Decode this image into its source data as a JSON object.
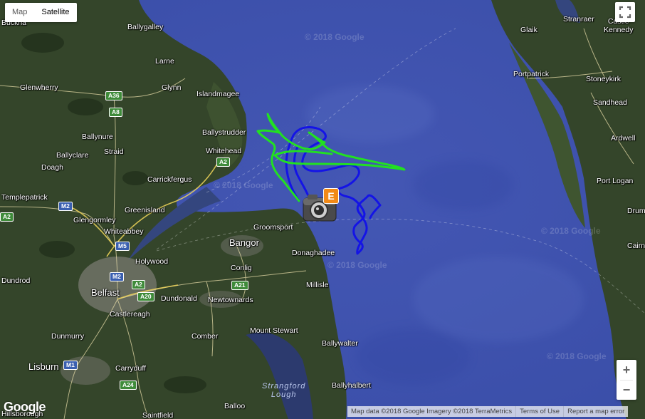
{
  "map_type": {
    "options": [
      "Map",
      "Satellite"
    ],
    "selected": "Satellite"
  },
  "controls": {
    "zoom_in": "+",
    "zoom_out": "−",
    "fullscreen_icon": "fullscreen-icon"
  },
  "watermark": "© 2018 Google",
  "labels": {
    "buckna": "Buckna",
    "ballygalley": "Ballygalley",
    "larne": "Larne",
    "glenwherry": "Glenwherry",
    "glynn": "Glynn",
    "islandmagee": "Islandmagee",
    "ballynure": "Ballynure",
    "ballystrudder": "Ballystrudder",
    "ballyclare": "Ballyclare",
    "straid": "Straid",
    "whitehead": "Whitehead",
    "doagh": "Doagh",
    "carrickfergus": "Carrickfergus",
    "templepatrick": "Templepatrick",
    "greenisland": "Greenisland",
    "glengormley": "Glengormley",
    "whiteabbey": "Whiteabbey",
    "groomsport": "Groomsport",
    "bangor": "Bangor",
    "donaghadee": "Donaghadee",
    "holywood": "Holywood",
    "conlig": "Conlig",
    "dundrod": "Dundrod",
    "belfast": "Belfast",
    "dundonald": "Dundonald",
    "newtownards": "Newtownards",
    "millisle": "Millisle",
    "castlereagh": "Castlereagh",
    "dunmurry": "Dunmurry",
    "comber": "Comber",
    "mount_stewart": "Mount Stewart",
    "ballywalter": "Ballywalter",
    "lisburn": "Lisburn",
    "carryduff": "Carryduff",
    "strangford_lough": "Strangford\nLough",
    "ballyhalbert": "Ballyhalbert",
    "hillsborough": "Hillsborough",
    "balloo": "Balloo",
    "saintfield": "Saintfield",
    "glaik": "Glaik",
    "stranraer": "Stranraer",
    "castle_kennedy": "Castle\nKennedy",
    "portpatrick": "Portpatrick",
    "stoneykirk": "Stoneykirk",
    "sandhead": "Sandhead",
    "ardwell": "Ardwell",
    "port_logan": "Port Logan",
    "drum": "Drum",
    "cairn": "Cairn"
  },
  "road_shields": [
    "A36",
    "A8",
    "A2",
    "M2",
    "M5",
    "M2",
    "A2",
    "A20",
    "A21",
    "M1",
    "A24",
    "A2"
  ],
  "marker": {
    "letter": "E",
    "icon": "camera-icon"
  },
  "tracks": {
    "blue_color": "#1414e6",
    "green_color": "#22e022"
  },
  "attribution": {
    "text": "Map data ©2018 Google Imagery ©2018 TerraMetrics",
    "terms": "Terms of Use",
    "report": "Report a map error"
  },
  "google_logo": "Google"
}
